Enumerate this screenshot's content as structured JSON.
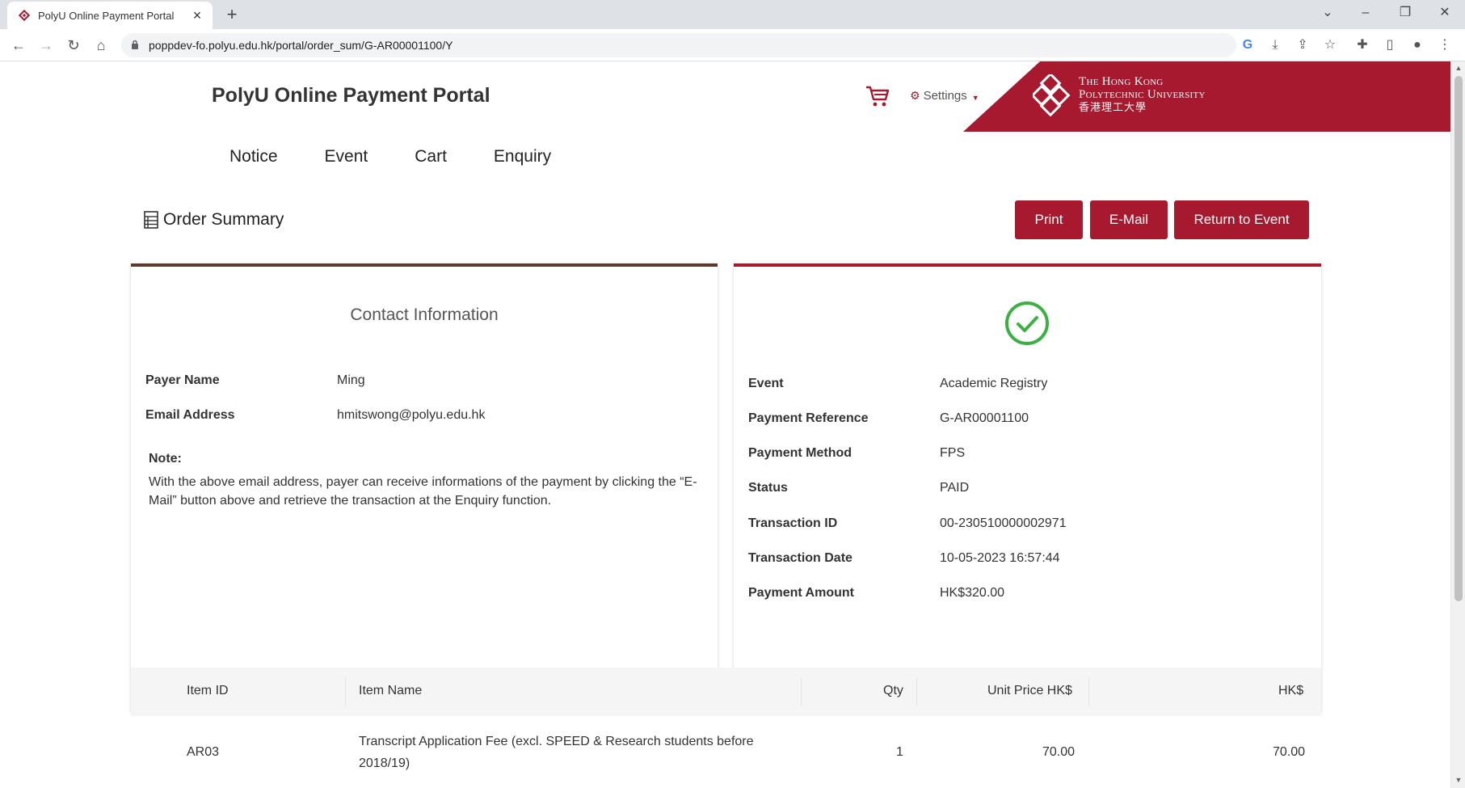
{
  "browser": {
    "tab_title": "PolyU Online Payment Portal",
    "new_tab_symbol": "+",
    "url": "poppdev-fo.polyu.edu.hk/portal/order_sum/G-AR00001100/Y"
  },
  "header": {
    "brand": "PolyU Online Payment Portal",
    "settings_label": "Settings",
    "logo_line1": "The Hong Kong",
    "logo_line2": "Polytechnic University",
    "logo_line3": "香港理工大學"
  },
  "nav": {
    "items": [
      {
        "label": "Notice"
      },
      {
        "label": "Event"
      },
      {
        "label": "Cart"
      },
      {
        "label": "Enquiry"
      }
    ]
  },
  "order_summary": {
    "title": "Order Summary",
    "buttons": {
      "print": "Print",
      "email": "E-Mail",
      "return": "Return to Event"
    }
  },
  "contact": {
    "heading": "Contact Information",
    "payer_name_label": "Payer Name",
    "payer_name": "Ming",
    "email_label": "Email Address",
    "email": "hmitswong@polyu.edu.hk",
    "note_title": "Note:",
    "note_text": "With the above email address, payer can receive informations of the payment by clicking the “E-Mail” button above and retrieve the transaction at the Enquiry function."
  },
  "payment": {
    "status_icon": "check-circle-icon",
    "rows": [
      {
        "label": "Event",
        "value": "Academic Registry"
      },
      {
        "label": "Payment Reference",
        "value": "G-AR00001100"
      },
      {
        "label": "Payment Method",
        "value": "FPS"
      },
      {
        "label": "Status",
        "value": "PAID"
      },
      {
        "label": "Transaction ID",
        "value": "00-230510000002971"
      },
      {
        "label": "Transaction Date",
        "value": "10-05-2023 16:57:44"
      },
      {
        "label": "Payment Amount",
        "value": "HK$320.00"
      }
    ]
  },
  "items_table": {
    "headers": {
      "item_id": "Item ID",
      "item_name": "Item Name",
      "qty": "Qty",
      "unit_price": "Unit Price HK$",
      "amount": "HK$"
    },
    "rows": [
      {
        "item_id": "AR03",
        "item_name": "Transcript Application Fee (excl. SPEED & Research students before 2018/19)",
        "qty": "1",
        "unit_price": "70.00",
        "amount": "70.00"
      }
    ]
  },
  "colors": {
    "brand_red": "#a6192e",
    "brown_accent": "#5a3b2e",
    "success_green": "#3cb043"
  }
}
